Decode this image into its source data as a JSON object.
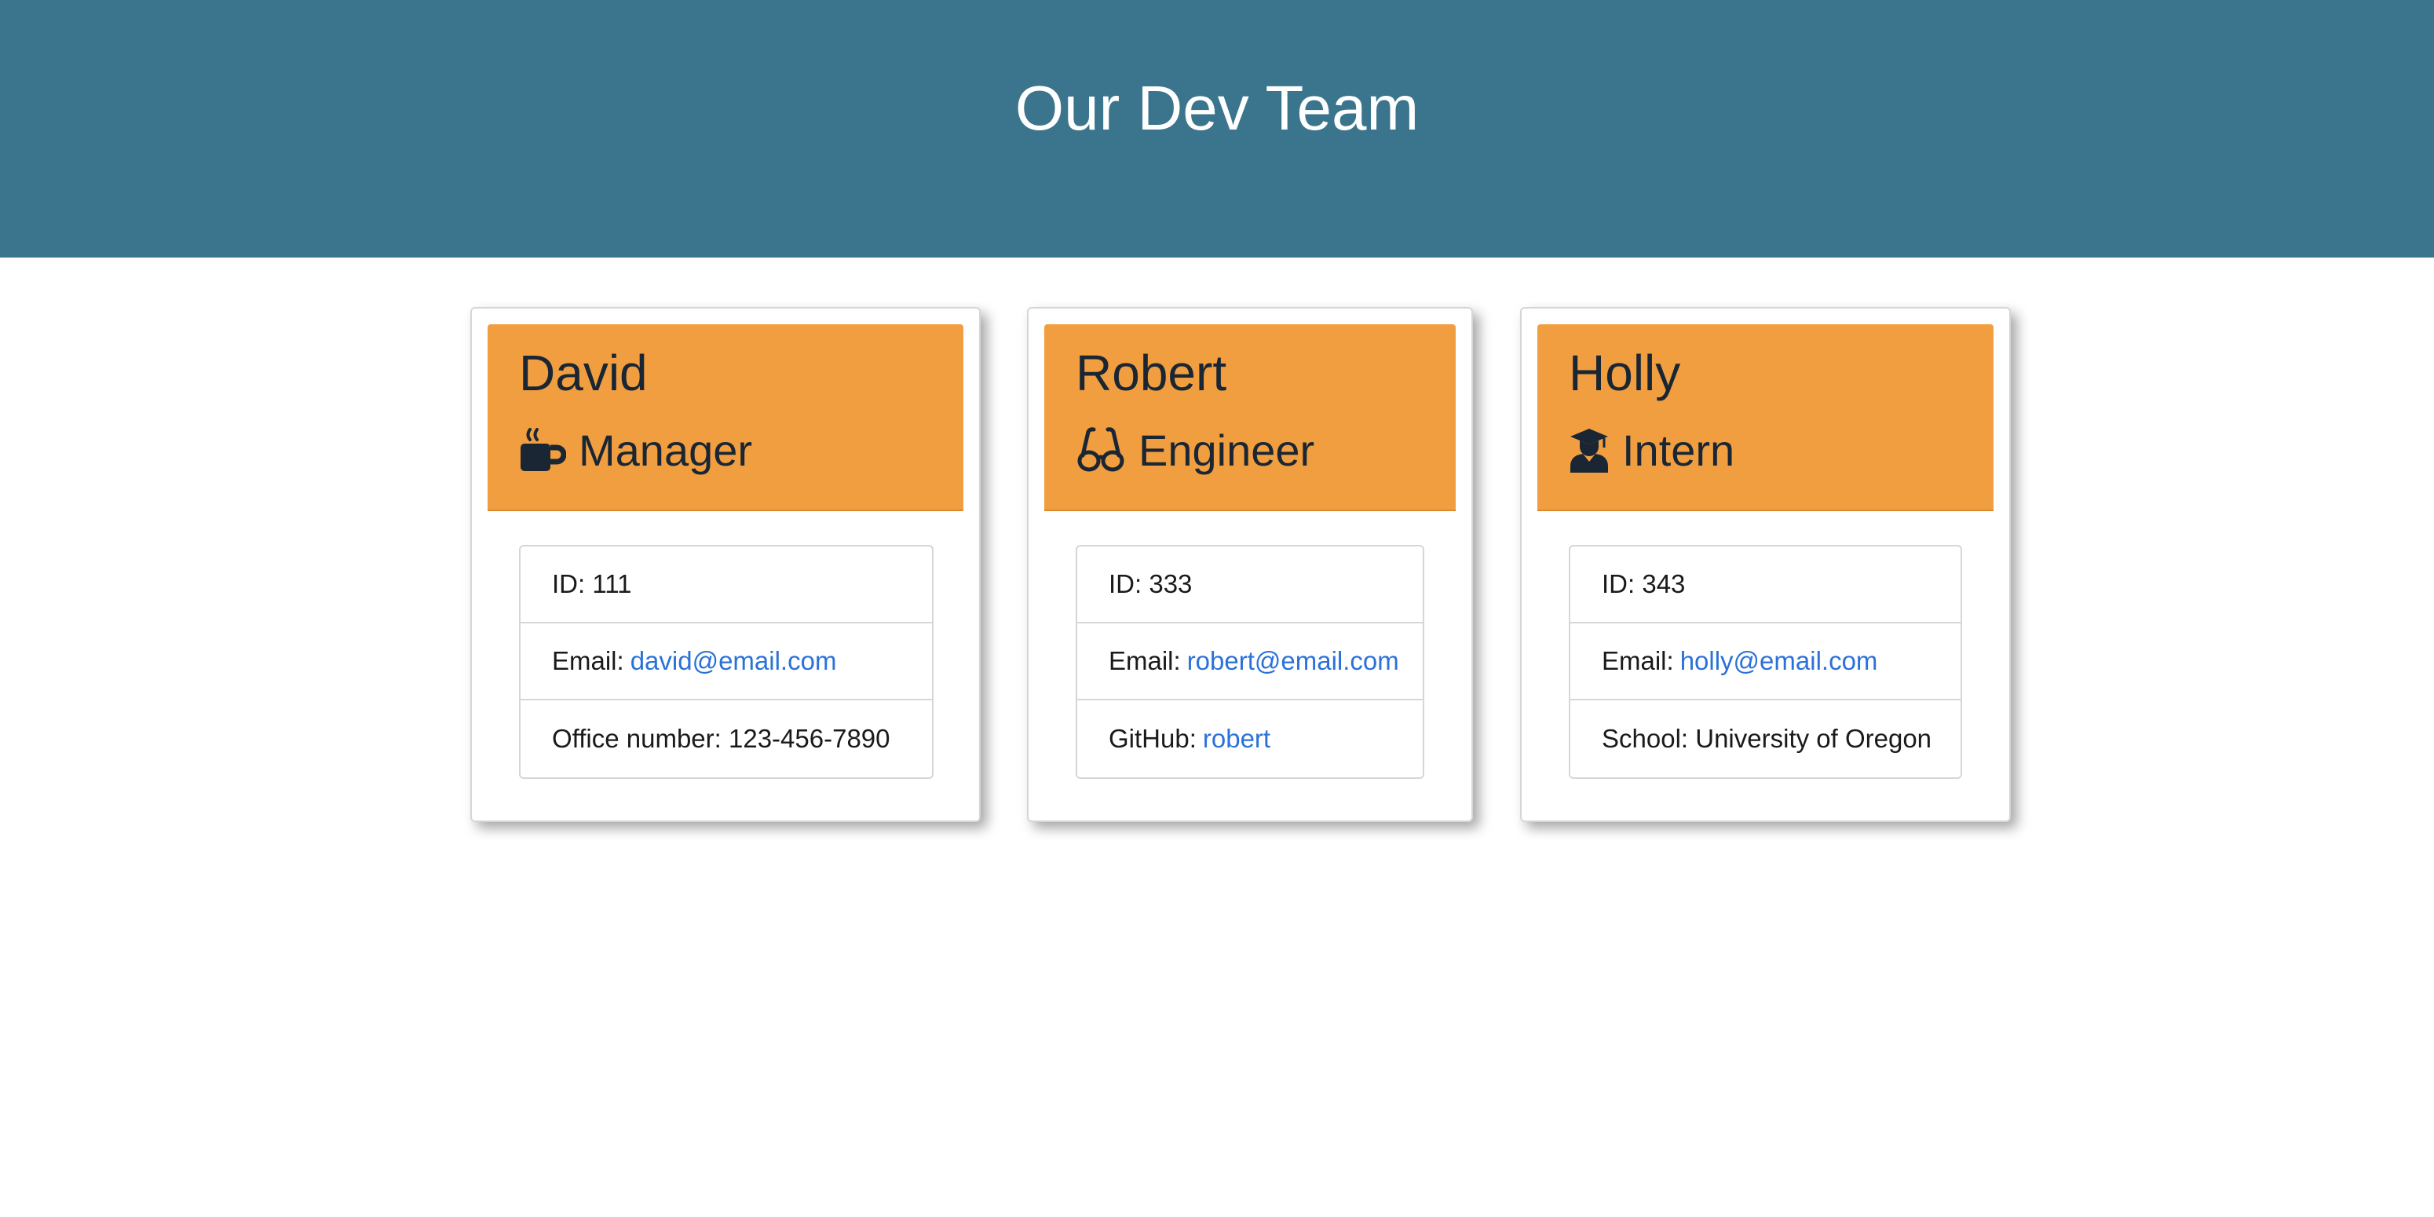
{
  "page": {
    "title": "Our Dev Team"
  },
  "employees": [
    {
      "name": "David",
      "role": "Manager",
      "icon": "coffee-mug-icon",
      "id_label": "ID:",
      "id": "111",
      "email_label": "Email:",
      "email": "david@email.com",
      "extra_label": "Office number:",
      "extra_value": "123-456-7890"
    },
    {
      "name": "Robert",
      "role": "Engineer",
      "icon": "glasses-icon",
      "id_label": "ID:",
      "id": "333",
      "email_label": "Email:",
      "email": "robert@email.com",
      "extra_label": "GitHub:",
      "extra_value": "robert"
    },
    {
      "name": "Holly",
      "role": "Intern",
      "icon": "graduate-icon",
      "id_label": "ID:",
      "id": "343",
      "email_label": "Email:",
      "email": "holly@email.com",
      "extra_label": "School:",
      "extra_value": "University of Oregon"
    }
  ],
  "colors": {
    "header_bg": "#3a748d",
    "card_head_bg": "#f09e40",
    "link": "#2a72d8",
    "text_dark": "#1a2633"
  }
}
